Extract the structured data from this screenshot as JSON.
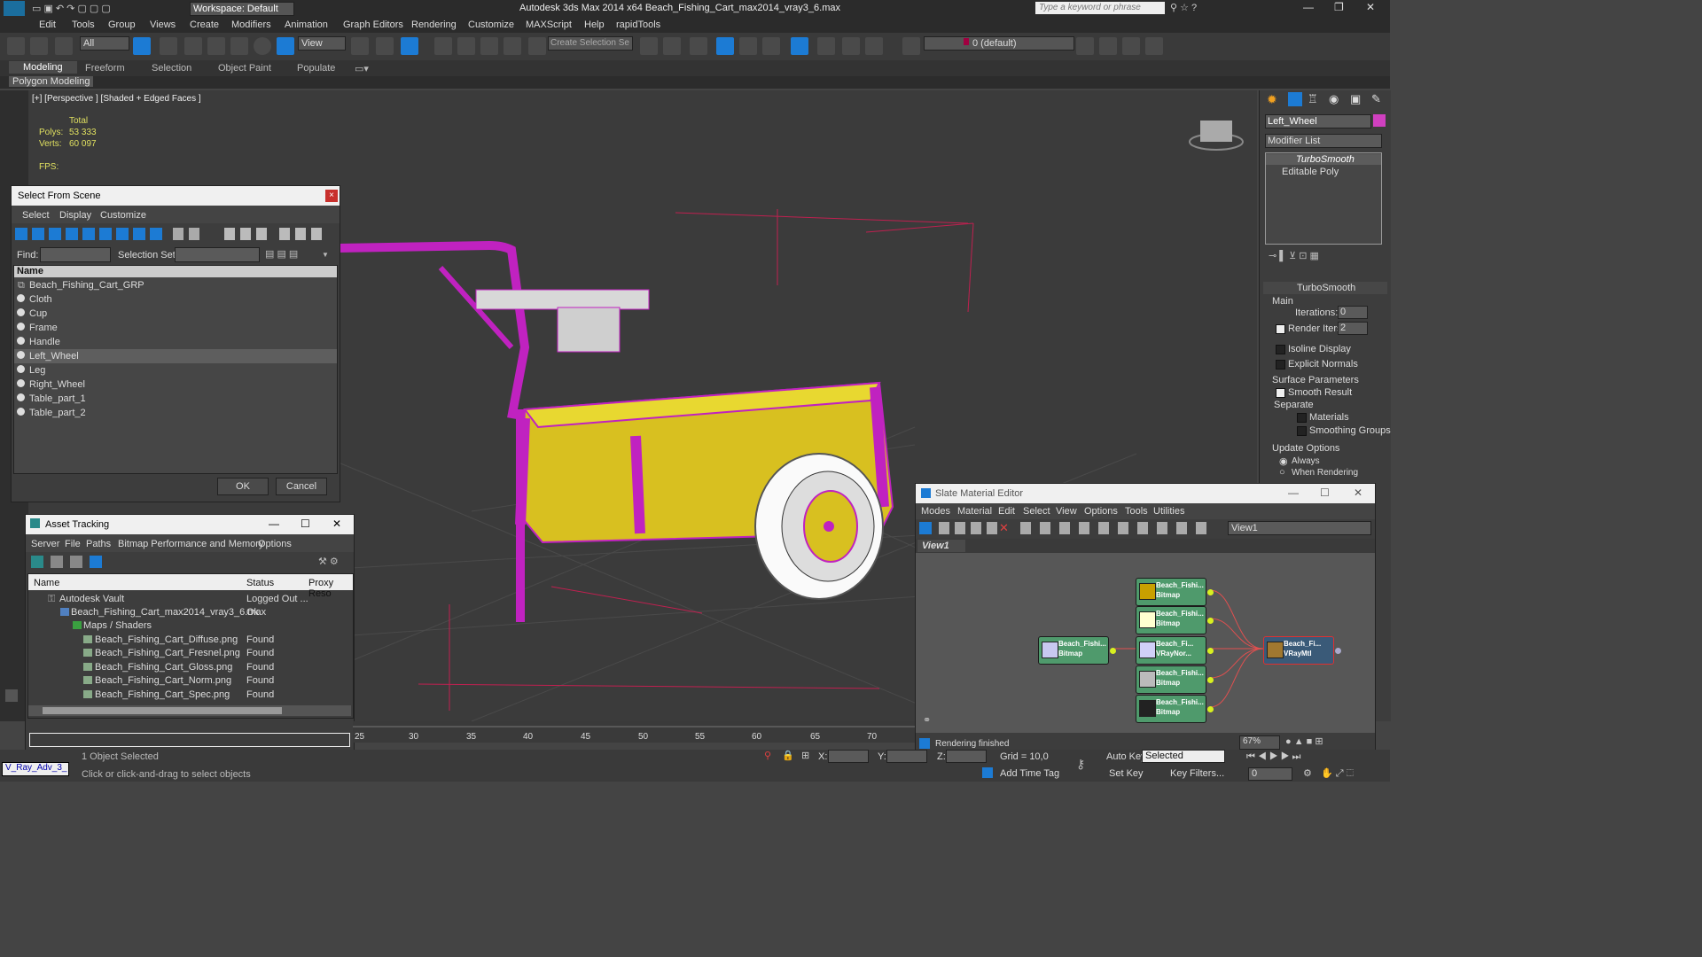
{
  "app": {
    "workspace": "Workspace: Default",
    "title": "Autodesk 3ds Max  2014 x64     Beach_Fishing_Cart_max2014_vray3_6.max",
    "search_placeholder": "Type a keyword or phrase"
  },
  "menu": [
    "Edit",
    "Tools",
    "Group",
    "Views",
    "Create",
    "Modifiers",
    "Animation",
    "Graph Editors",
    "Rendering",
    "Customize",
    "MAXScript",
    "Help",
    "rapidTools"
  ],
  "toolbar": {
    "filter": "All",
    "view": "View",
    "selset": "Create Selection Se",
    "layer": "0 (default)"
  },
  "ribbon": {
    "tabs": [
      "Modeling",
      "Freeform",
      "Selection",
      "Object Paint",
      "Populate"
    ],
    "sub": "Polygon Modeling"
  },
  "viewport": {
    "label": "[+] [Perspective ] [Shaded + Edged Faces ]",
    "stats": {
      "total": "Total",
      "polys_label": "Polys:",
      "polys": "53 333",
      "verts_label": "Verts:",
      "verts": "60 097",
      "fps": "FPS:"
    }
  },
  "select_from_scene": {
    "title": "Select From Scene",
    "menu": [
      "Select",
      "Display",
      "Customize"
    ],
    "find_label": "Find:",
    "selset_label": "Selection Set:",
    "col_name": "Name",
    "items": [
      "Beach_Fishing_Cart_GRP",
      "Cloth",
      "Cup",
      "Frame",
      "Handle",
      "Left_Wheel",
      "Leg",
      "Right_Wheel",
      "Table_part_1",
      "Table_part_2"
    ],
    "ok": "OK",
    "cancel": "Cancel"
  },
  "asset_tracking": {
    "title": "Asset Tracking",
    "menu": [
      "Server",
      "File",
      "Paths",
      "Bitmap Performance and Memory",
      "Options"
    ],
    "cols": [
      "Name",
      "Status",
      "Proxy Reso"
    ],
    "rows": [
      {
        "name": "Autodesk Vault",
        "status": "Logged Out ..."
      },
      {
        "name": "Beach_Fishing_Cart_max2014_vray3_6.max",
        "status": "Ok"
      },
      {
        "name": "Maps / Shaders",
        "status": ""
      },
      {
        "name": "Beach_Fishing_Cart_Diffuse.png",
        "status": "Found"
      },
      {
        "name": "Beach_Fishing_Cart_Fresnel.png",
        "status": "Found"
      },
      {
        "name": "Beach_Fishing_Cart_Gloss.png",
        "status": "Found"
      },
      {
        "name": "Beach_Fishing_Cart_Norm.png",
        "status": "Found"
      },
      {
        "name": "Beach_Fishing_Cart_Spec.png",
        "status": "Found"
      }
    ]
  },
  "command_panel": {
    "object_name": "Left_Wheel",
    "modifier_list": "Modifier List",
    "stack": [
      "TurboSmooth",
      "Editable Poly"
    ],
    "rollout": "TurboSmooth",
    "main": "Main",
    "iterations_label": "Iterations:",
    "iterations": "0",
    "render_iters_label": "Render Iters:",
    "render_iters": "2",
    "isoline": "Isoline Display",
    "explicit": "Explicit Normals",
    "surface": "Surface Parameters",
    "smooth_result": "Smooth Result",
    "separate": "Separate",
    "materials": "Materials",
    "smoothing_groups": "Smoothing Groups",
    "update": "Update Options",
    "always": "Always",
    "when_rendering": "When Rendering"
  },
  "slate": {
    "title": "Slate Material Editor",
    "menu": [
      "Modes",
      "Material",
      "Edit",
      "Select",
      "View",
      "Options",
      "Tools",
      "Utilities"
    ],
    "view_select": "View1",
    "view_tab": "View1",
    "status": "Rendering finished",
    "nodes": [
      {
        "name": "Beach_Fishi...",
        "type": "Bitmap"
      },
      {
        "name": "Beach_Fishi...",
        "type": "Bitmap"
      },
      {
        "name": "Beach_Fishi...",
        "type": "Bitmap"
      },
      {
        "name": "Beach_Fi...",
        "type": "VRayNor..."
      },
      {
        "name": "Beach_Fishi...",
        "type": "Bitmap"
      },
      {
        "name": "Beach_Fishi...",
        "type": "Bitmap"
      },
      {
        "name": "Beach_Fi...",
        "type": "VRayMtl"
      }
    ]
  },
  "timeline": {
    "ticks": [
      "25",
      "30",
      "35",
      "40",
      "45",
      "50",
      "55",
      "60",
      "65",
      "70"
    ]
  },
  "statusbar": {
    "left_label": "V_Ray_Adv_3_",
    "objects": "1 Object Selected",
    "prompt": "Click or click-and-drag to select objects",
    "x": "X:",
    "y": "Y:",
    "z": "Z:",
    "grid": "Grid = 10,0",
    "add_time_tag": "Add Time Tag",
    "auto_key": "Auto Key",
    "set_key": "Set Key",
    "selected": "Selected",
    "key_filters": "Key Filters...",
    "frame": "0",
    "zoom": "67%"
  },
  "colors": {
    "accent": "#1c7bd4",
    "wire": "#c022c0",
    "basket": "#d8c020"
  }
}
